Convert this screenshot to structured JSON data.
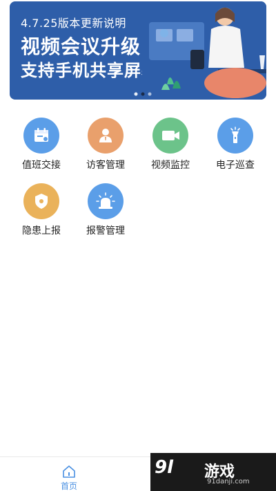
{
  "banner": {
    "version": "4.7.25版本更新说明",
    "title_line1": "视频会议升级",
    "title_line2": "支持手机共享屏幕",
    "bg_color": "#2e5ea9"
  },
  "menu": [
    {
      "label": "值班交接",
      "icon": "calendar-icon",
      "color": "#5b9ee8"
    },
    {
      "label": "访客管理",
      "icon": "person-icon",
      "color": "#e9a06c"
    },
    {
      "label": "视频监控",
      "icon": "video-camera-icon",
      "color": "#6cc38a"
    },
    {
      "label": "电子巡查",
      "icon": "flashlight-icon",
      "color": "#5b9ee8"
    },
    {
      "label": "隐患上报",
      "icon": "shield-alert-icon",
      "color": "#eab25a"
    },
    {
      "label": "报警管理",
      "icon": "alarm-light-icon",
      "color": "#5b9ee8"
    }
  ],
  "tabbar": {
    "home_label": "首页",
    "home_icon": "home-icon",
    "active_color": "#4a90e2"
  },
  "watermark": {
    "logo": "9l",
    "text": "游戏",
    "url": "91danji.com"
  }
}
